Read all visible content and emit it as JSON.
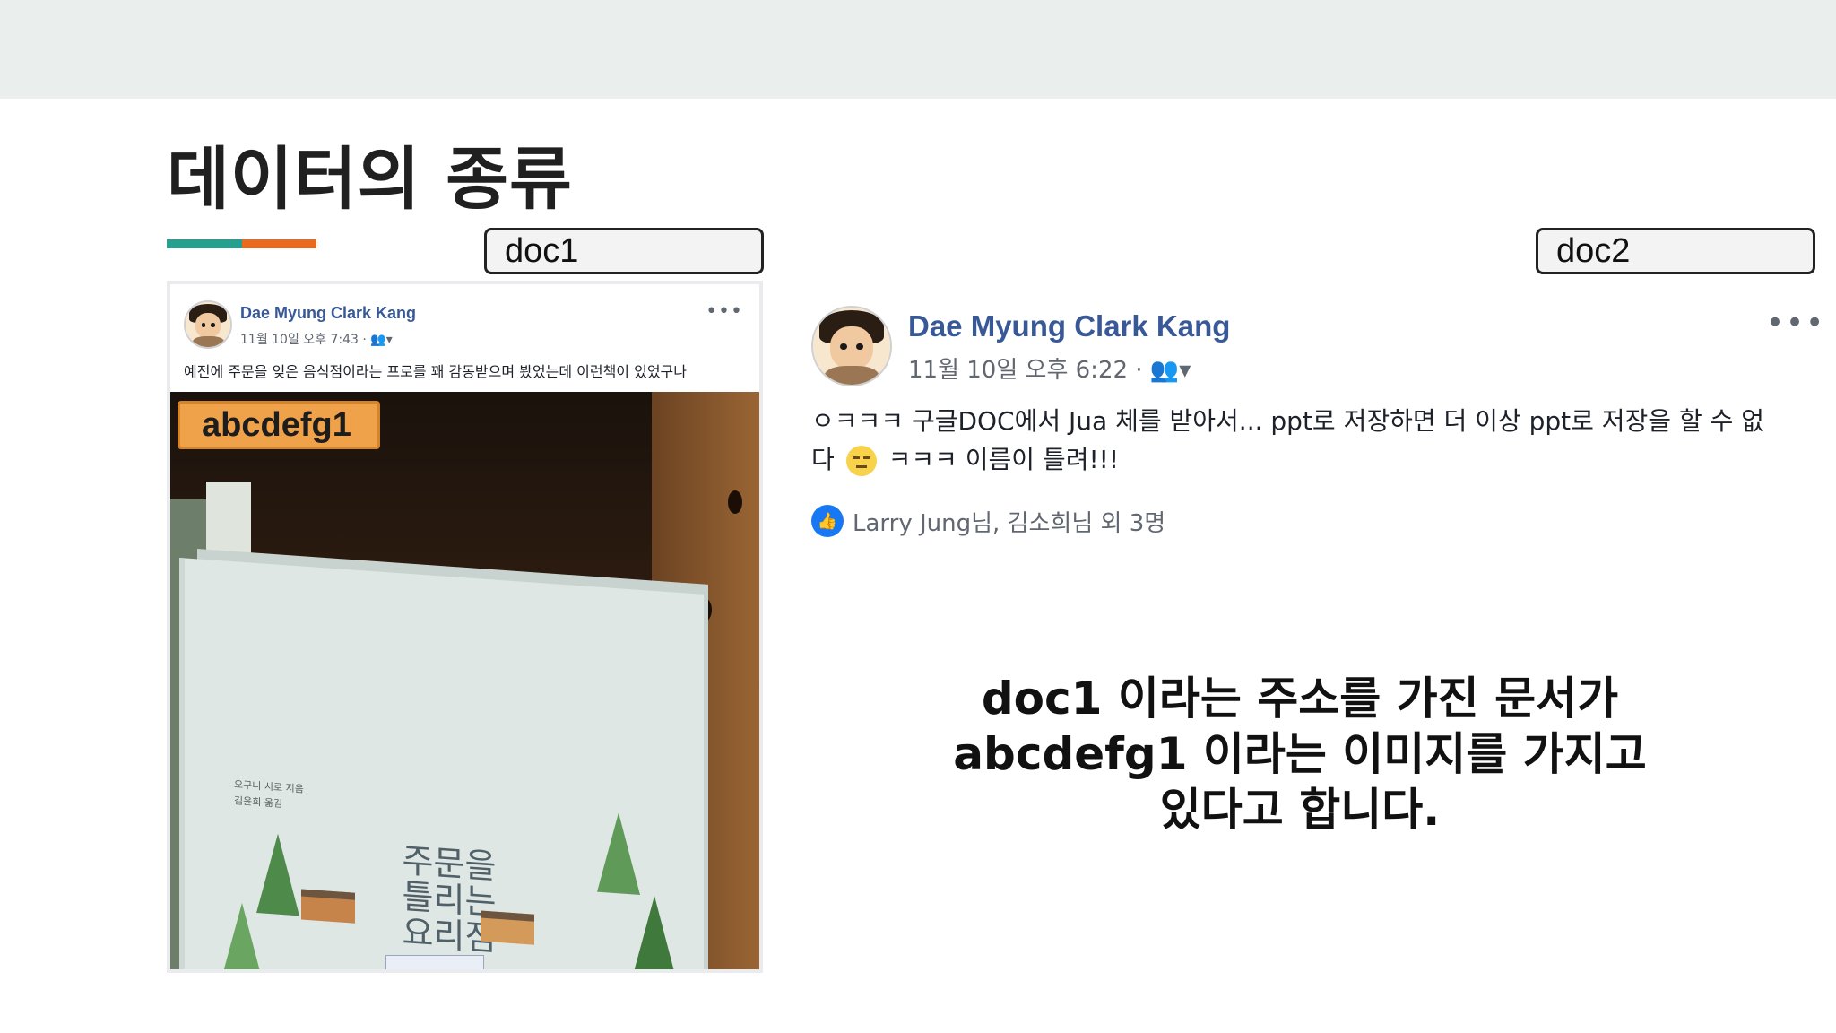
{
  "slide": {
    "title": "데이터의 종류",
    "accent_colors": [
      "#25a08e",
      "#e96b1e"
    ]
  },
  "tags": {
    "doc1": "doc1",
    "doc2": "doc2"
  },
  "post_small": {
    "author": "Dae Myung Clark Kang",
    "meta": "11월 10일 오후 7:43 · 👥▾",
    "more": "•••",
    "text": "예전에 주문을 잊은 음식점이라는 프로를 꽤 감동받으며 봤었는데 이런책이 있었구나",
    "image_label": "abcdefg1",
    "book": {
      "title": "주문을 틀리는 요리점",
      "author_lines": [
        "오구니 시로 지음",
        "김윤희 옮김"
      ]
    }
  },
  "post_large": {
    "author": "Dae Myung Clark Kang",
    "meta": "11월 10일 오후 6:22 · 👥▾",
    "more": "•••",
    "text_part1": "ㅇㅋㅋㅋ 구글DOC에서 Jua 체를 받아서... ppt로 저장하면 더 이상 ppt로 저장을 할 수 없다",
    "text_part2": "ㅋㅋㅋ 이름이 틀려!!!",
    "likes_icon": "like-icon",
    "likes": "Larry Jung님, 김소희님 외 3명"
  },
  "caption": {
    "line1": "doc1 이라는 주소를 가진 문서가",
    "line2": "abcdefg1 이라는 이미지를 가지고",
    "line3": "있다고 합니다."
  }
}
